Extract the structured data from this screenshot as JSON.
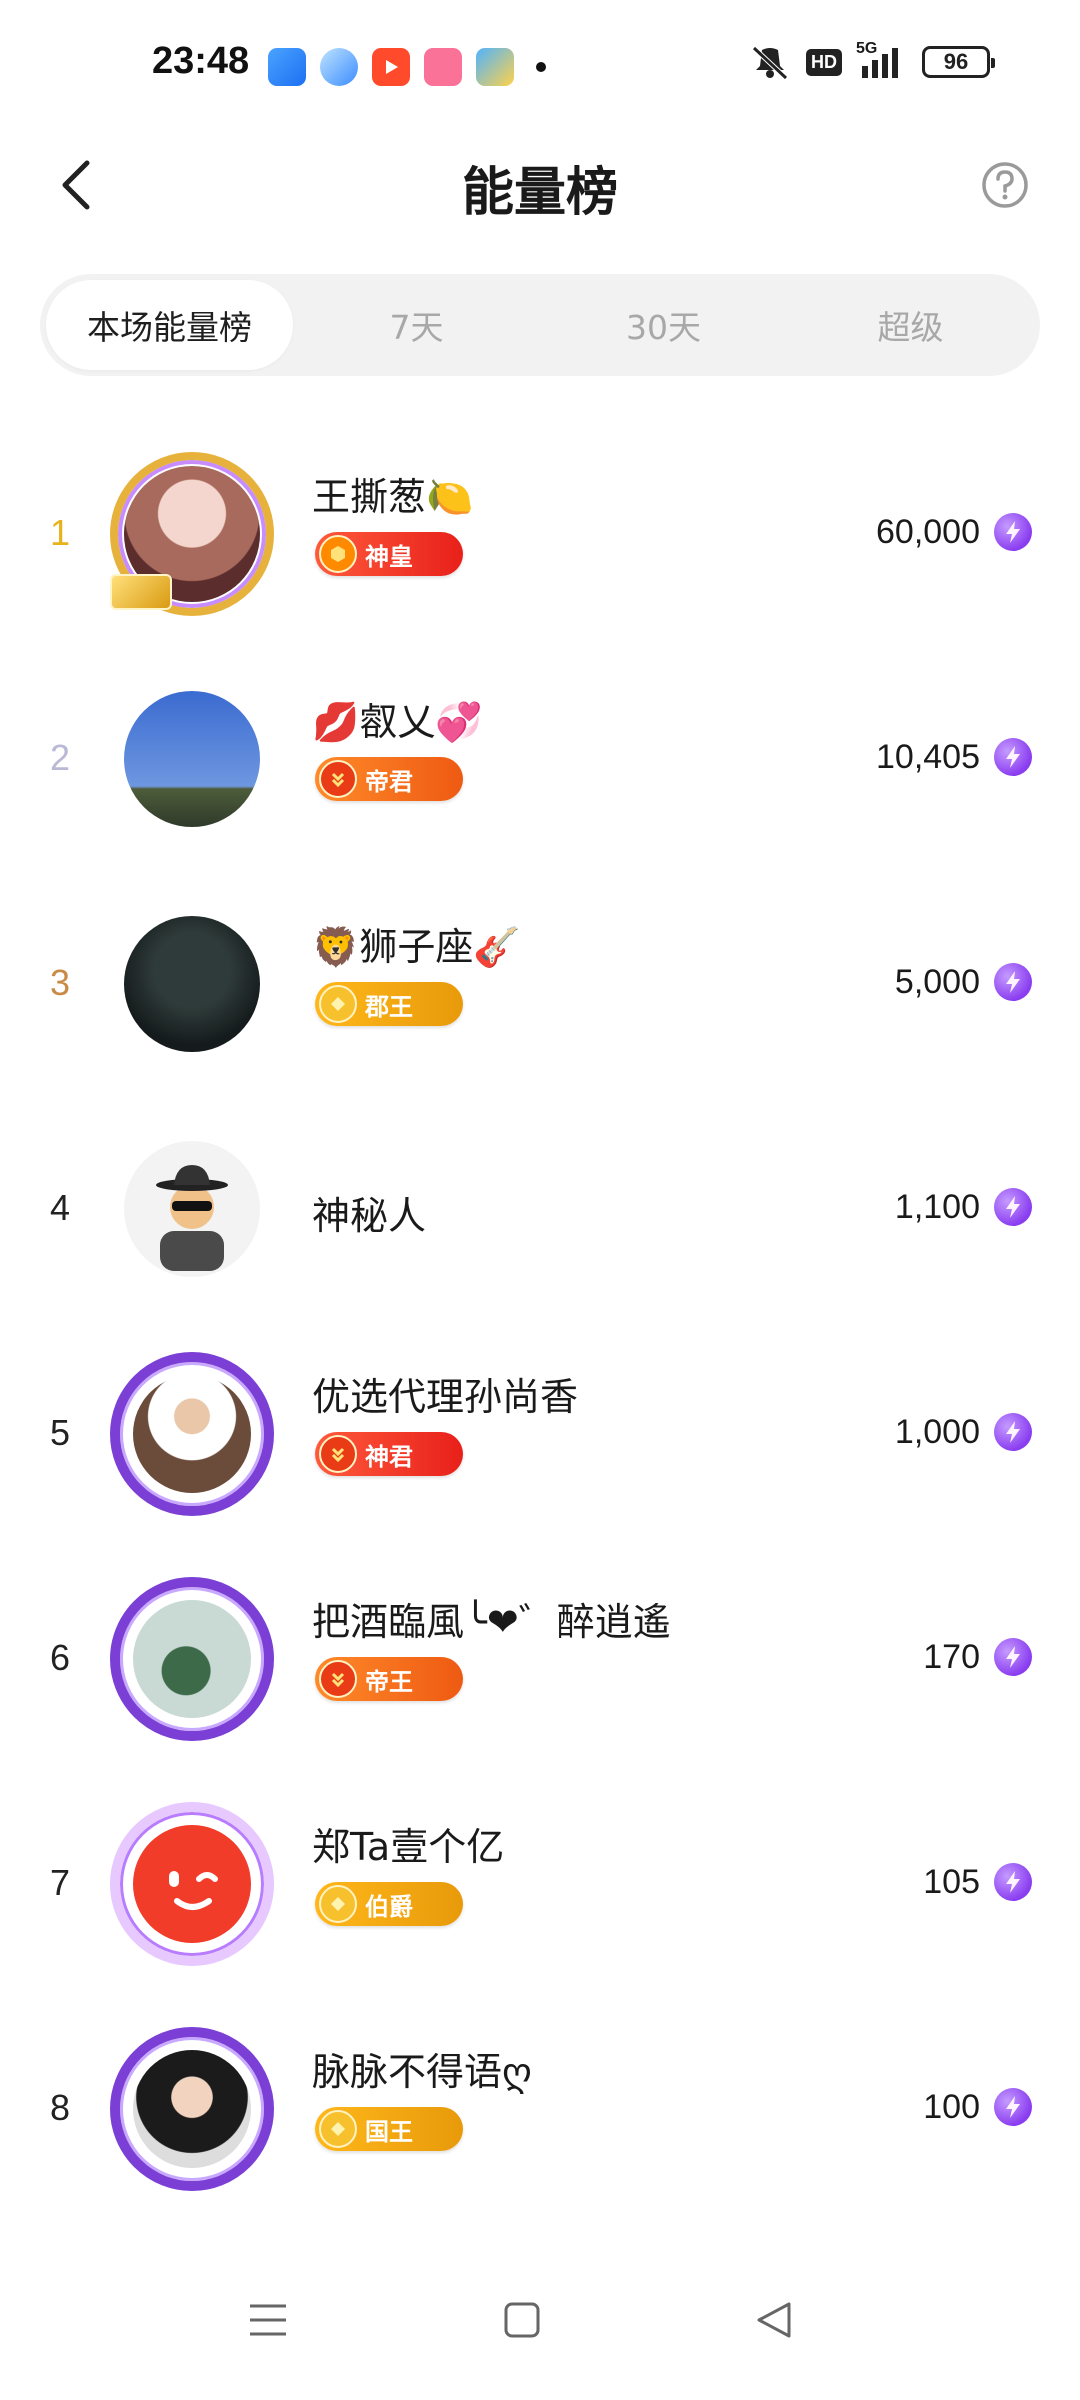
{
  "status_bar": {
    "time": "23:48",
    "battery": "96",
    "apps": [
      "files-app-icon",
      "feather-app-icon",
      "video-app-icon",
      "bilibili-app-icon",
      "weather-app-icon"
    ],
    "hd_label": "HD",
    "network_label": "5G"
  },
  "header": {
    "title": "能量榜"
  },
  "tabs": [
    {
      "label": "本场能量榜",
      "active": true
    },
    {
      "label": "7天",
      "active": false
    },
    {
      "label": "30天",
      "active": false
    },
    {
      "label": "超级",
      "active": false
    }
  ],
  "ranking": [
    {
      "rank": "1",
      "name": "王撕葱🍋",
      "badge": "神皇",
      "score": "60,000"
    },
    {
      "rank": "2",
      "name": "💋㕡乂💞",
      "badge": "帝君",
      "score": "10,405"
    },
    {
      "rank": "3",
      "name": "🦁狮子座🎸",
      "badge": "郡王",
      "score": "5,000"
    },
    {
      "rank": "4",
      "name": "神秘人",
      "badge": "",
      "score": "1,100"
    },
    {
      "rank": "5",
      "name": "优选代理孙尚香",
      "badge": "神君",
      "score": "1,000"
    },
    {
      "rank": "6",
      "name": "把酒臨風╰❤゛醉逍遙",
      "badge": "帝王",
      "score": "170"
    },
    {
      "rank": "7",
      "name": "郑Ta壹个亿",
      "badge": "伯爵",
      "score": "105"
    },
    {
      "rank": "8",
      "name": "脉脉不得语ღ",
      "badge": "国王",
      "score": "100"
    }
  ],
  "colors": {
    "rank1": "#e8b21c",
    "rank2": "#b9b9d6",
    "rank3": "#c98a45",
    "energy": "#8a3df0"
  }
}
